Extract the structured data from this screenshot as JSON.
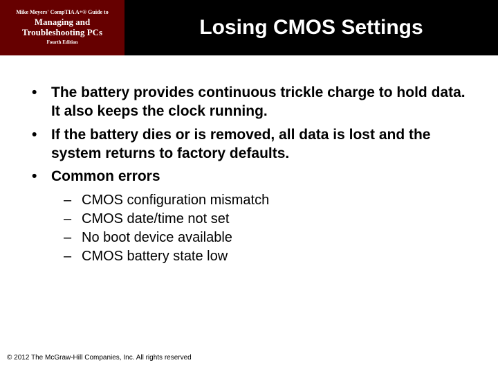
{
  "header": {
    "book_line1": "Mike Meyers' CompTIA A+® Guide to",
    "book_line2": "Managing and Troubleshooting PCs",
    "book_line3": "Fourth Edition",
    "slide_title": "Losing CMOS Settings"
  },
  "content": {
    "bullets": [
      "The battery provides continuous trickle charge to hold data. It also keeps the clock running.",
      "If the battery dies or is removed, all data is lost and the system returns to factory defaults.",
      "Common errors"
    ],
    "sub_bullets": [
      "CMOS configuration mismatch",
      "CMOS date/time not set",
      "No boot device available",
      "CMOS battery state low"
    ]
  },
  "footer": {
    "copyright": "© 2012 The McGraw-Hill Companies, Inc. All rights reserved"
  }
}
